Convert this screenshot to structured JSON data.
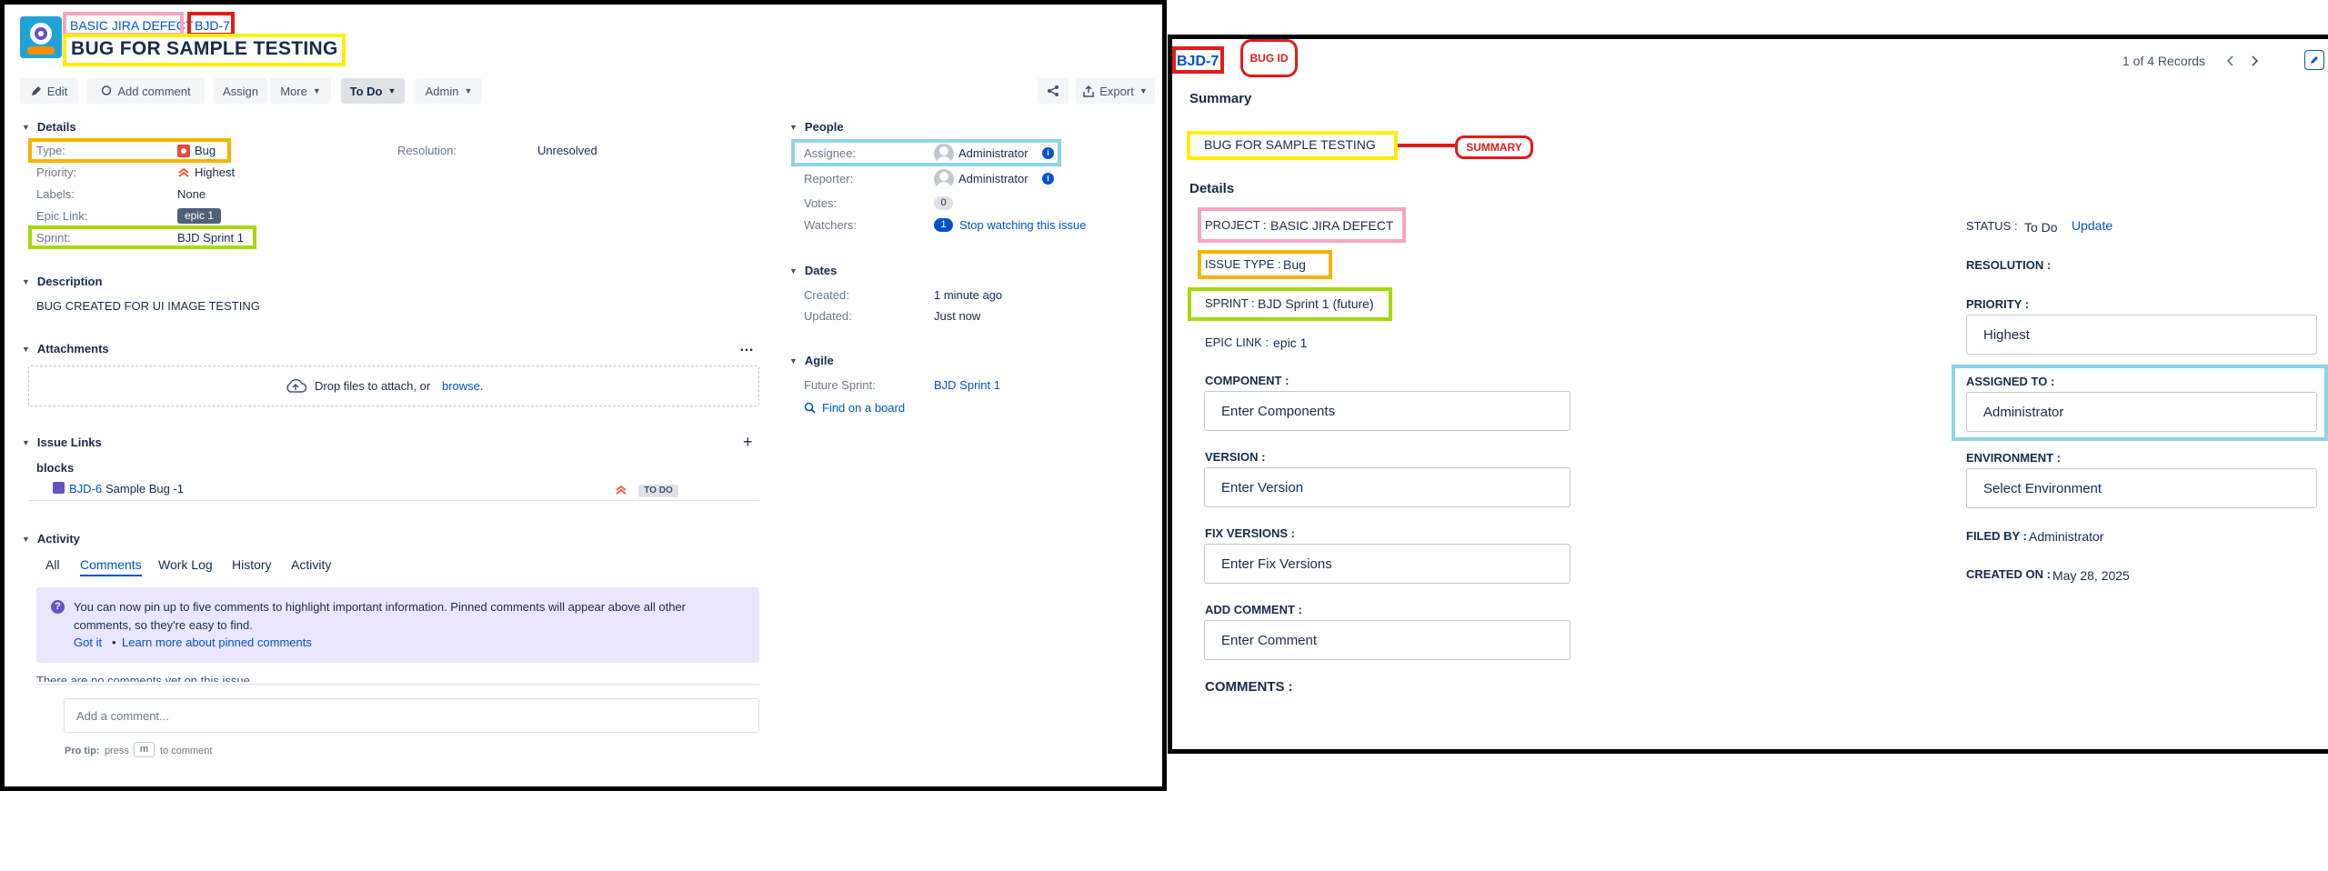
{
  "left": {
    "breadcrumb": {
      "project": "BASIC JIRA DEFECT",
      "issue_key": "BJD-7"
    },
    "title": "BUG FOR SAMPLE TESTING",
    "toolbar": {
      "edit": "Edit",
      "add_comment": "Add comment",
      "assign": "Assign",
      "more": "More",
      "status": "To Do",
      "admin": "Admin",
      "export": "Export"
    },
    "details": {
      "heading": "Details",
      "type_label": "Type:",
      "type_value": "Bug",
      "priority_label": "Priority:",
      "priority_value": "Highest",
      "labels_label": "Labels:",
      "labels_value": "None",
      "epic_label": "Epic Link:",
      "epic_value": "epic 1",
      "sprint_label": "Sprint:",
      "sprint_value": "BJD Sprint 1",
      "resolution_label": "Resolution:",
      "resolution_value": "Unresolved"
    },
    "description": {
      "heading": "Description",
      "text": "BUG CREATED FOR UI IMAGE TESTING"
    },
    "attachments": {
      "heading": "Attachments",
      "more": "…",
      "drop_text": "Drop files to attach, or",
      "browse": "browse."
    },
    "issue_links": {
      "heading": "Issue Links",
      "add": "+",
      "relation": "blocks",
      "link_key": "BJD-6",
      "link_summary": "Sample Bug -1",
      "link_status": "TO DO"
    },
    "activity": {
      "heading": "Activity",
      "tabs": [
        "All",
        "Comments",
        "Work Log",
        "History",
        "Activity"
      ],
      "info_line1": "You can now pin up to five comments to highlight important information. Pinned comments will appear above all other",
      "info_line2": "comments, so they're easy to find.",
      "got_it": "Got it",
      "bullet": "•",
      "learn_more": "Learn more about pinned comments",
      "no_comments": "There are no comments yet on this issue.",
      "add_comment_placeholder": "Add a comment...",
      "pro_tip_bold": "Pro tip:",
      "pro_tip_text": "press",
      "pro_tip_key": "m",
      "pro_tip_end": "to comment"
    },
    "people": {
      "heading": "People",
      "assignee_label": "Assignee:",
      "assignee_value": "Administrator",
      "reporter_label": "Reporter:",
      "reporter_value": "Administrator",
      "votes_label": "Votes:",
      "votes_value": "0",
      "watchers_label": "Watchers:",
      "watchers_count": "1",
      "watchers_action": "Stop watching this issue"
    },
    "dates": {
      "heading": "Dates",
      "created_label": "Created:",
      "created_value": "1 minute ago",
      "updated_label": "Updated:",
      "updated_value": "Just now"
    },
    "agile": {
      "heading": "Agile",
      "future_sprint_label": "Future Sprint:",
      "future_sprint_value": "BJD Sprint 1",
      "find_on_board": "Find on a board"
    }
  },
  "right": {
    "bug_id": "BJD-7",
    "bug_id_callout": "BUG ID",
    "records": "1 of 4 Records",
    "summary_heading": "Summary",
    "summary_value": "BUG FOR SAMPLE TESTING",
    "summary_callout": "SUMMARY",
    "details_heading": "Details",
    "project_label": "PROJECT :",
    "project_value": "BASIC JIRA DEFECT",
    "issue_type_label": "ISSUE TYPE :",
    "issue_type_value": "Bug",
    "sprint_label": "SPRINT :",
    "sprint_value": "BJD Sprint 1 (future)",
    "epic_label": "EPIC LINK :",
    "epic_value": "epic 1",
    "component_label": "COMPONENT :",
    "component_placeholder": "Enter Components",
    "version_label": "VERSION :",
    "version_placeholder": "Enter Version",
    "fix_versions_label": "FIX VERSIONS :",
    "fix_versions_placeholder": "Enter Fix Versions",
    "add_comment_label": "ADD COMMENT :",
    "add_comment_placeholder": "Enter Comment",
    "comments_label": "COMMENTS :",
    "status_label": "STATUS :",
    "status_value": "To Do",
    "status_action": "Update",
    "resolution_label": "RESOLUTION :",
    "priority_label": "PRIORITY :",
    "priority_value": "Highest",
    "assigned_to_label": "ASSIGNED TO :",
    "assigned_to_value": "Administrator",
    "environment_label": "ENVIRONMENT :",
    "environment_placeholder": "Select Environment",
    "filed_by_label": "FILED BY :",
    "filed_by_value": "Administrator",
    "created_on_label": "CREATED ON :",
    "created_on_value": "May 28, 2025"
  },
  "colors": {
    "pink": "#f4a6c0",
    "red": "#e31b1b",
    "yellow": "#ffee00",
    "orange": "#f5b400",
    "lime": "#a6d80a",
    "cyan": "#8fd3e6",
    "jira_blue": "#0052cc"
  },
  "icons": [
    "project-avatar-icon",
    "pencil-icon",
    "comment-icon",
    "chevron-down-icon",
    "share-icon",
    "export-icon",
    "bug-type-icon",
    "priority-highest-icon",
    "cloud-upload-icon",
    "info-icon",
    "question-icon",
    "search-icon",
    "chevron-left-icon",
    "chevron-right-icon",
    "edit-icon"
  ]
}
